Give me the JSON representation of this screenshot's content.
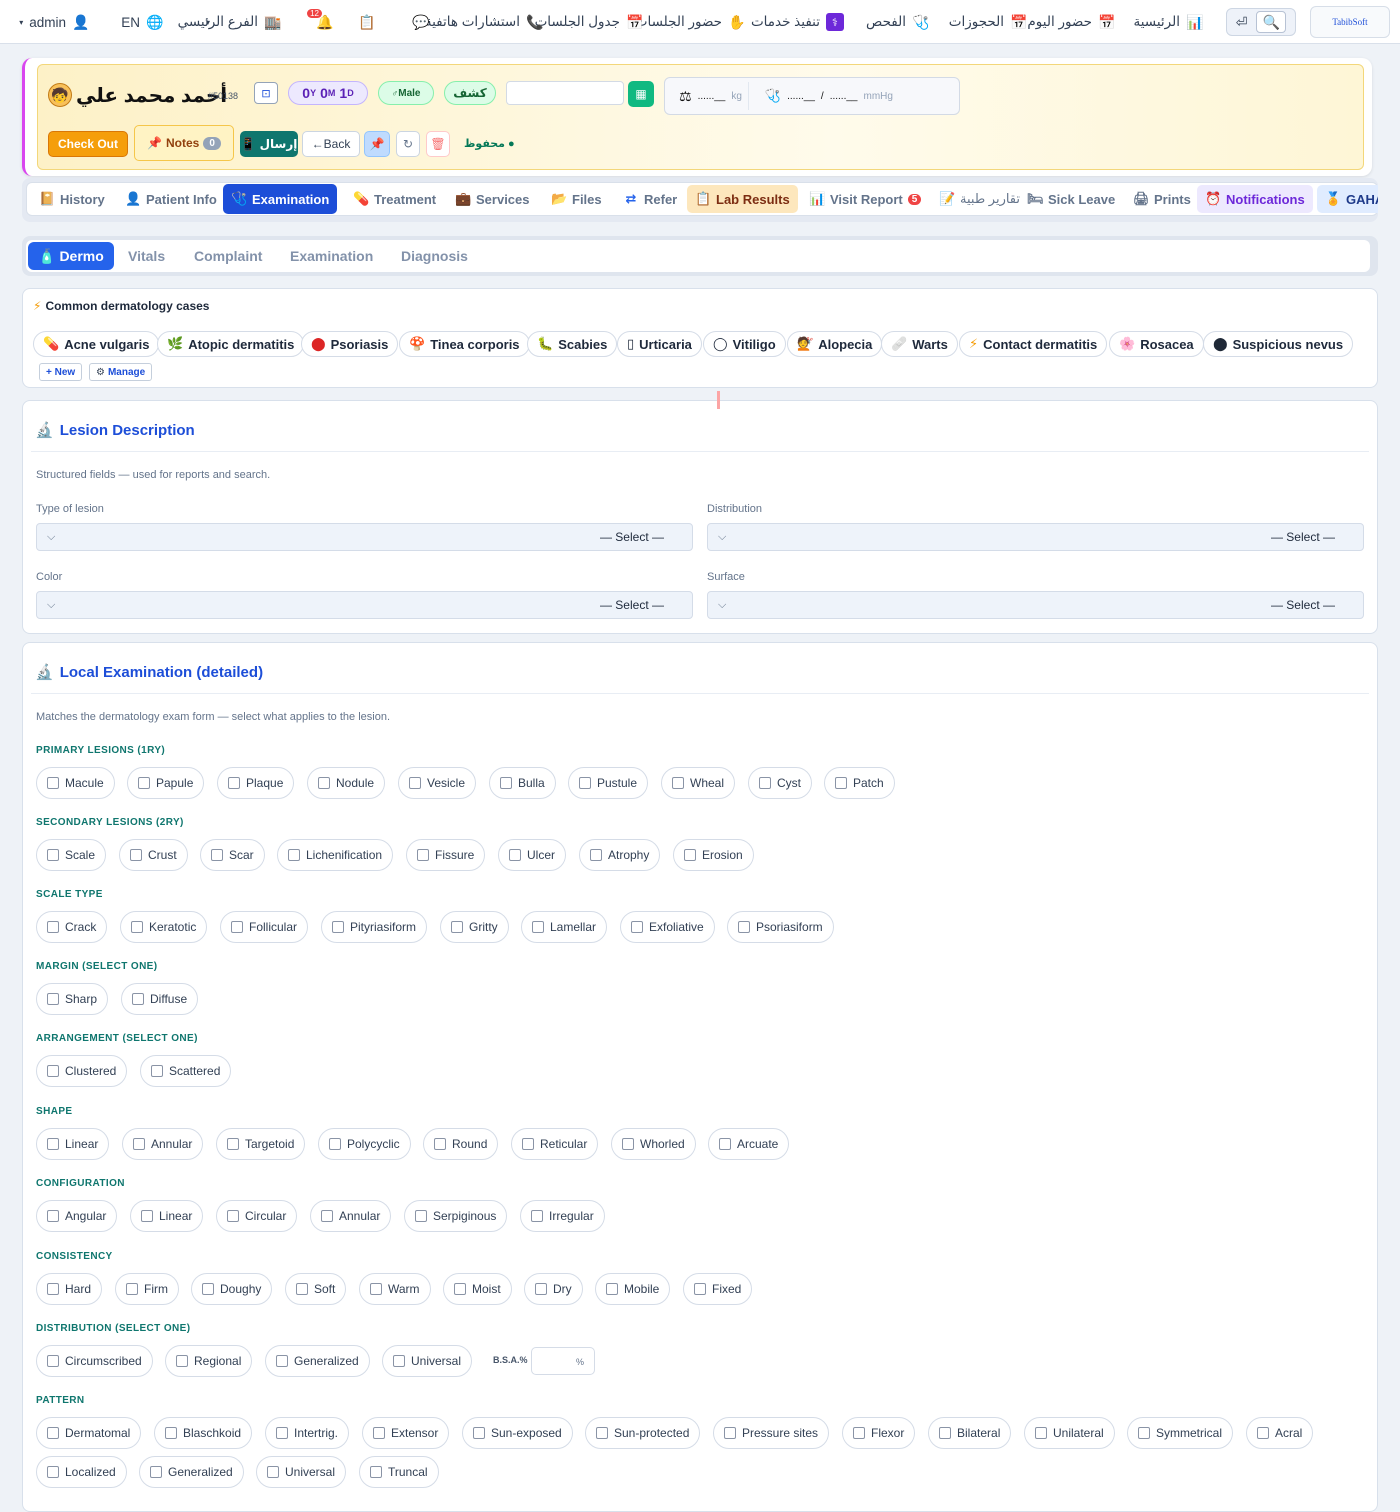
{
  "topnav": {
    "logo": "TabibSoft",
    "items": [
      {
        "label": "الرئيسية",
        "icon": "chart-icon"
      },
      {
        "label": "حضور اليوم",
        "icon": "calendar-icon"
      },
      {
        "label": "الحجوزات",
        "icon": "calendar-icon"
      },
      {
        "label": "الفحص",
        "icon": "stethoscope-icon"
      },
      {
        "label": "تنفيذ خدمات",
        "icon": "service-icon"
      },
      {
        "label": "حضور الجلسات",
        "icon": "hand-icon"
      },
      {
        "label": "جدول الجلسات",
        "icon": "calendar-icon"
      },
      {
        "label": "استشارات هاتفية",
        "icon": "phone-icon"
      }
    ],
    "branch": "الفرع الرئيسي",
    "lang": "EN",
    "user": "admin",
    "bell_badge": "12"
  },
  "patient": {
    "name": "أحمد محمد علي",
    "id": "#50138",
    "age": {
      "y": "0",
      "y_unit": "Y",
      "m": "0",
      "m_unit": "M",
      "d": "1",
      "d_unit": "D"
    },
    "gender": "Male",
    "visit_type": "كشف",
    "weight_unit": "kg",
    "bp_sep": "/",
    "bp_unit": "mmHg",
    "checkout": "Check Out",
    "notes": "Notes",
    "notes_count": "0",
    "send": "إرسال",
    "back": "←Back",
    "status": "محفوظ"
  },
  "tabs": [
    {
      "label": "History",
      "icon": "history-icon"
    },
    {
      "label": "Patient Info",
      "icon": "user-icon"
    },
    {
      "label": "Examination",
      "icon": "stethoscope-icon"
    },
    {
      "label": "Treatment",
      "icon": "pill-icon"
    },
    {
      "label": "Services",
      "icon": "briefcase-icon"
    },
    {
      "label": "Files",
      "icon": "folder-icon"
    },
    {
      "label": "Refer",
      "icon": "refer-icon"
    },
    {
      "label": "Lab Results",
      "icon": "clipboard-icon"
    },
    {
      "label": "Visit Report",
      "icon": "report-icon",
      "badge": "5"
    },
    {
      "label": "تقارير طبية",
      "icon": "memo-icon"
    },
    {
      "label": "Sick Leave",
      "icon": "bed-icon"
    },
    {
      "label": "Prints",
      "icon": "printer-icon"
    },
    {
      "label": "Notifications",
      "icon": "alarm-icon"
    },
    {
      "label": "GAHA",
      "icon": "medal-icon"
    }
  ],
  "subtabs": [
    "Dermo",
    "Vitals",
    "Complaint",
    "Examination",
    "Diagnosis"
  ],
  "common": {
    "title": "Common dermatology cases",
    "cases": [
      "Acne vulgaris",
      "Atopic dermatitis",
      "Psoriasis",
      "Tinea corporis",
      "Scabies",
      "Urticaria",
      "Vitiligo",
      "Alopecia",
      "Warts",
      "Contact dermatitis",
      "Rosacea",
      "Suspicious nevus"
    ],
    "new": "+ New",
    "manage": "Manage"
  },
  "lesion": {
    "title": "Lesion Description",
    "help": "Structured fields — used for reports and search.",
    "fields": [
      {
        "label": "Type of lesion",
        "value": "— Select —"
      },
      {
        "label": "Distribution",
        "value": "— Select —"
      },
      {
        "label": "Color",
        "value": "— Select —"
      },
      {
        "label": "Surface",
        "value": "— Select —"
      }
    ]
  },
  "local": {
    "title": "Local Examination (detailed)",
    "help": "Matches the dermatology exam form — select what applies to the lesion.",
    "groups": [
      {
        "title": "PRIMARY LESIONS (1RY)",
        "options": [
          "Macule",
          "Papule",
          "Plaque",
          "Nodule",
          "Vesicle",
          "Bulla",
          "Pustule",
          "Wheal",
          "Cyst",
          "Patch"
        ]
      },
      {
        "title": "SECONDARY LESIONS (2RY)",
        "options": [
          "Scale",
          "Crust",
          "Scar",
          "Lichenification",
          "Fissure",
          "Ulcer",
          "Atrophy",
          "Erosion"
        ]
      },
      {
        "title": "SCALE TYPE",
        "options": [
          "Crack",
          "Keratotic",
          "Follicular",
          "Pityriasiform",
          "Gritty",
          "Lamellar",
          "Exfoliative",
          "Psoriasiform"
        ]
      },
      {
        "title": "MARGIN (SELECT ONE)",
        "options": [
          "Sharp",
          "Diffuse"
        ]
      },
      {
        "title": "ARRANGEMENT (SELECT ONE)",
        "options": [
          "Clustered",
          "Scattered"
        ]
      },
      {
        "title": "SHAPE",
        "options": [
          "Linear",
          "Annular",
          "Targetoid",
          "Polycyclic",
          "Round",
          "Reticular",
          "Whorled",
          "Arcuate"
        ]
      },
      {
        "title": "CONFIGURATION",
        "options": [
          "Angular",
          "Linear",
          "Circular",
          "Annular",
          "Serpiginous",
          "Irregular"
        ]
      },
      {
        "title": "CONSISTENCY",
        "options": [
          "Hard",
          "Firm",
          "Doughy",
          "Soft",
          "Warm",
          "Moist",
          "Dry",
          "Mobile",
          "Fixed"
        ]
      },
      {
        "title": "DISTRIBUTION (SELECT ONE)",
        "options": [
          "Circumscribed",
          "Regional",
          "Generalized",
          "Universal"
        ],
        "bsa_label": "B.S.A.%",
        "bsa_unit": "%"
      },
      {
        "title": "PATTERN",
        "options": [
          "Dermatomal",
          "Blaschkoid",
          "Intertrig.",
          "Extensor",
          "Sun-exposed",
          "Sun-protected",
          "Pressure sites",
          "Flexor",
          "Bilateral",
          "Unilateral",
          "Symmetrical",
          "Acral",
          "Localized",
          "Generalized",
          "Universal",
          "Truncal"
        ]
      }
    ]
  }
}
